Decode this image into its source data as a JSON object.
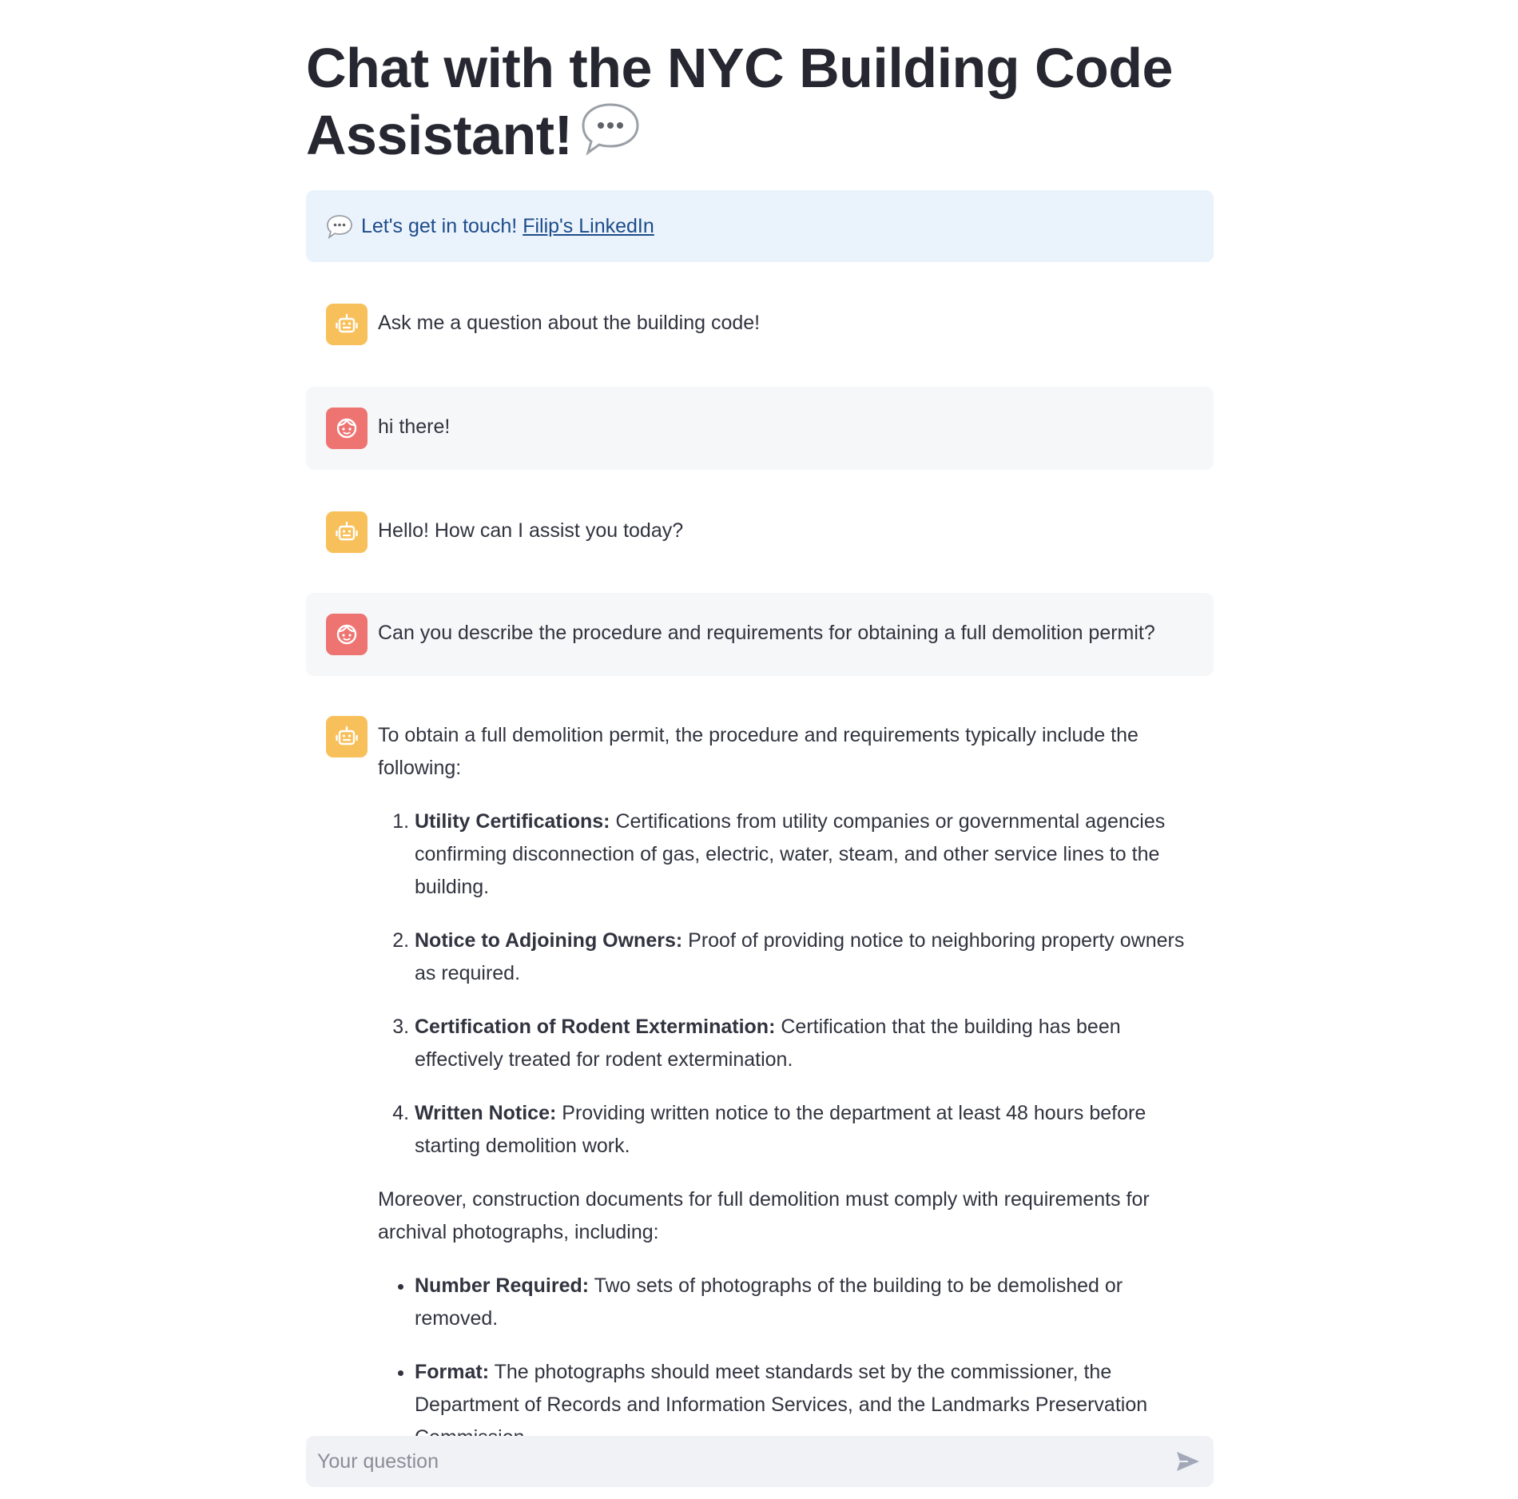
{
  "title": {
    "text": "Chat with the NYC Building Code Assistant!",
    "emoji": "speech-balloon-icon"
  },
  "info": {
    "text": "Let's get in touch!",
    "link_label": "Filip's LinkedIn",
    "icon": "speech-balloon-icon"
  },
  "messages": [
    {
      "role": "assistant",
      "avatar": "robot-icon",
      "text": "Ask me a question about the building code!"
    },
    {
      "role": "user",
      "avatar": "face-icon",
      "text": "hi there!"
    },
    {
      "role": "assistant",
      "avatar": "robot-icon",
      "text": "Hello! How can I assist you today?"
    },
    {
      "role": "user",
      "avatar": "face-icon",
      "text": "Can you describe the procedure and requirements for obtaining a full demolition permit?"
    },
    {
      "role": "assistant",
      "avatar": "robot-icon",
      "intro": "To obtain a full demolition permit, the procedure and requirements typically include the following:",
      "steps": [
        {
          "title": "Utility Certifications:",
          "text": "Certifications from utility companies or governmental agencies confirming disconnection of gas, electric, water, steam, and other service lines to the building."
        },
        {
          "title": "Notice to Adjoining Owners:",
          "text": "Proof of providing notice to neighboring property owners as required."
        },
        {
          "title": "Certification of Rodent Extermination:",
          "text": "Certification that the building has been effectively treated for rodent extermination."
        },
        {
          "title": "Written Notice:",
          "text": "Providing written notice to the department at least 48 hours before starting demolition work."
        }
      ],
      "middle": "Moreover, construction documents for full demolition must comply with requirements for archival photographs, including:",
      "bullets": [
        {
          "title": "Number Required:",
          "text": "Two sets of photographs of the building to be demolished or removed."
        },
        {
          "title": "Format:",
          "text": "The photographs should meet standards set by the commissioner, the Department of Records and Information Services, and the Landmarks Preservation Commission."
        }
      ]
    }
  ],
  "input": {
    "placeholder": "Your question",
    "value": ""
  },
  "colors": {
    "bot_avatar": "#f8c05a",
    "user_avatar": "#ee7472",
    "info_bg": "#eaf2fc",
    "info_text": "#1c4c89",
    "user_msg_bg": "#f6f7f9",
    "input_bg": "#f0f2f6"
  }
}
